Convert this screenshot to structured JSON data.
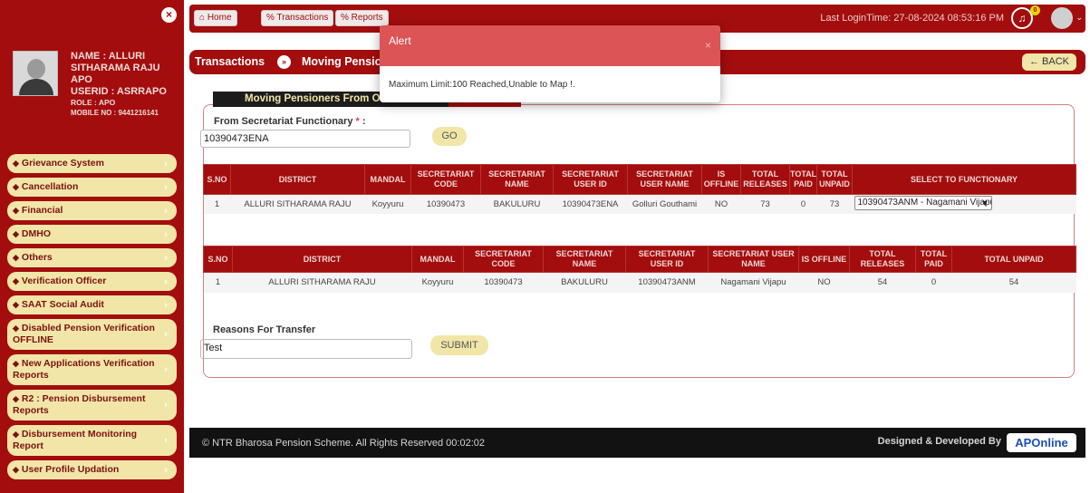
{
  "profile": {
    "name": "NAME : ALLURI SITHARAMA RAJU",
    "designation": "APO",
    "userid": "USERID : ASRRAPO",
    "role": "ROLE : APO",
    "mobile": "MOBILE NO : 9441216141"
  },
  "sidebar": {
    "close_icon": "×",
    "items": [
      {
        "label": "Grievance System"
      },
      {
        "label": "Cancellation"
      },
      {
        "label": "Financial"
      },
      {
        "label": "DMHO"
      },
      {
        "label": "Others"
      },
      {
        "label": "Verification Officer"
      },
      {
        "label": "SAAT Social Audit"
      },
      {
        "label": "Disabled Pension Verification OFFLINE"
      },
      {
        "label": "New Applications Verification Reports"
      },
      {
        "label": "R2 : Pension Disbursement Reports"
      },
      {
        "label": "Disbursement Monitoring Report"
      },
      {
        "label": "User Profile Updation"
      }
    ]
  },
  "topbar": {
    "home": "Home",
    "transactions": "Transactions",
    "reports": "Reports",
    "last_login": "Last LoginTime: 27-08-2024 08:53:16 PM",
    "notification_count": "0"
  },
  "breadcrumb": {
    "root": "Transactions",
    "current": "Moving Pension",
    "back": "BACK"
  },
  "form": {
    "section_title": "Moving Pensioners From On",
    "from_label": "From Secretariat Functionary",
    "required_mark": "*",
    "from_suffix": ":",
    "from_value": "10390473ENA",
    "go": "GO",
    "reasons_label": "Reasons For Transfer",
    "reasons_value": "Test",
    "submit": "SUBMIT"
  },
  "table1": {
    "headers": [
      "S.NO",
      "DISTRICT",
      "MANDAL",
      "SECRETARIAT CODE",
      "SECRETARIAT NAME",
      "SECRETARIAT USER ID",
      "SECRETARIAT USER NAME",
      "IS OFFLINE",
      "TOTAL RELEASES",
      "TOTAL PAID",
      "TOTAL UNPAID",
      "SELECT TO FUNCTIONARY"
    ],
    "row": [
      "1",
      "ALLURI SITHARAMA RAJU",
      "Koyyuru",
      "10390473",
      "BAKULURU",
      "10390473ENA",
      "Golluri Gouthami",
      "NO",
      "73",
      "0",
      "73"
    ],
    "select_value": "10390473ANM - Nagamani Vijapu"
  },
  "table2": {
    "headers": [
      "S.NO",
      "DISTRICT",
      "MANDAL",
      "SECRETARIAT CODE",
      "SECRETARIAT NAME",
      "SECRETARIAT USER ID",
      "SECRETARIAT USER NAME",
      "IS OFFLINE",
      "TOTAL RELEASES",
      "TOTAL PAID",
      "TOTAL UNPAID"
    ],
    "row": [
      "1",
      "ALLURI SITHARAMA RAJU",
      "Koyyuru",
      "10390473",
      "BAKULURU",
      "10390473ANM",
      "Nagamani Vijapu",
      "NO",
      "54",
      "0",
      "54"
    ]
  },
  "footer": {
    "copyright": "© NTR Bharosa Pension Scheme. All Rights Reserved   00:02:02",
    "designed": "Designed & Developed By",
    "logo": "APOnline"
  },
  "alert": {
    "title": "Alert",
    "close": "×",
    "message": "Maximum Limit:100 Reached,Unable to Map !."
  },
  "colors": {
    "brand_red": "#a30d0d",
    "menu_cream": "#f1e6a8",
    "alert_red": "#dc5456"
  }
}
